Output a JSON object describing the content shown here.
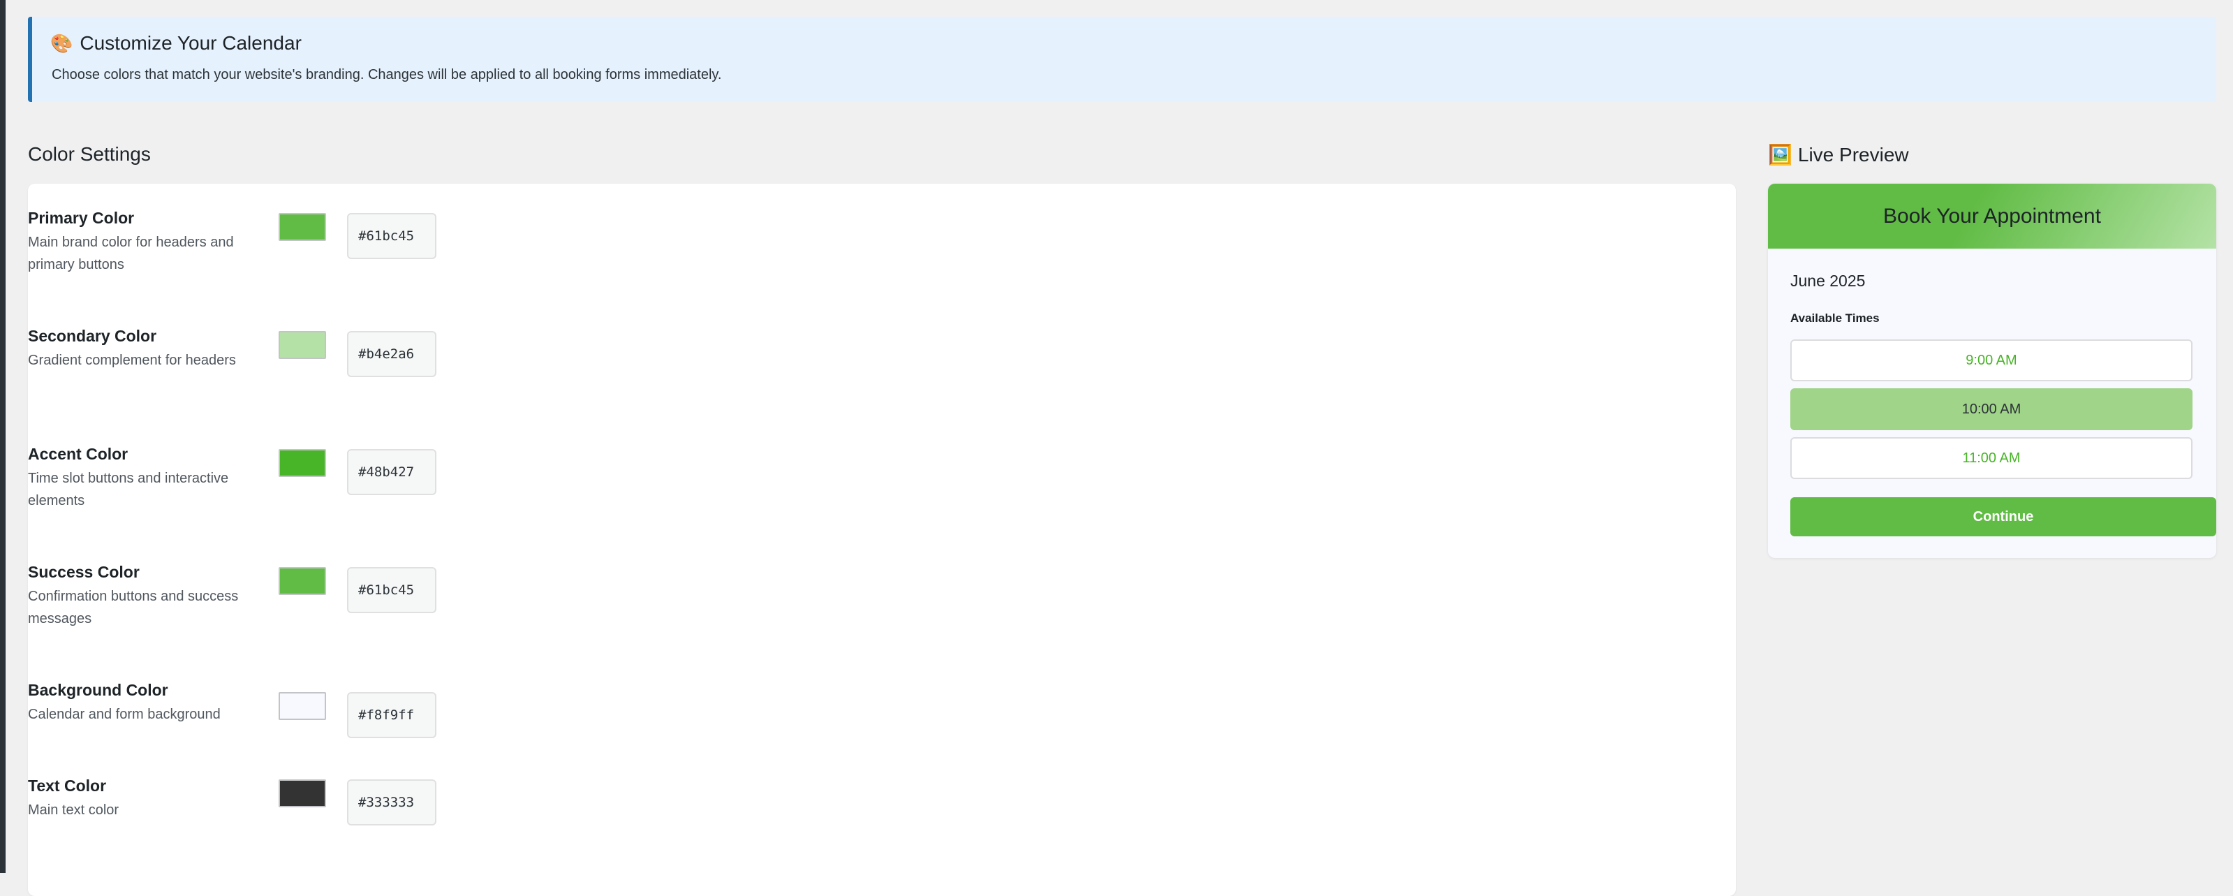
{
  "notice": {
    "icon": "palette-icon",
    "title": "Customize Your Calendar",
    "description": "Choose colors that match your website's branding. Changes will be applied to all booking forms immediately."
  },
  "settings": {
    "title": "Color Settings",
    "colors": [
      {
        "label": "Primary Color",
        "description": "Main brand color for headers and primary buttons",
        "value": "#61bc45"
      },
      {
        "label": "Secondary Color",
        "description": "Gradient complement for headers",
        "value": "#b4e2a6"
      },
      {
        "label": "Accent Color",
        "description": "Time slot buttons and interactive elements",
        "value": "#48b427"
      },
      {
        "label": "Success Color",
        "description": "Confirmation buttons and success messages",
        "value": "#61bc45"
      },
      {
        "label": "Background Color",
        "description": "Calendar and form background",
        "value": "#f8f9ff"
      },
      {
        "label": "Text Color",
        "description": "Main text color",
        "value": "#333333"
      }
    ]
  },
  "preview": {
    "icon": "picture-icon",
    "title": "Live Preview",
    "heading": "Book Your Appointment",
    "month": "June 2025",
    "available_label": "Available Times",
    "slots": [
      {
        "label": "9:00 AM",
        "selected": false
      },
      {
        "label": "10:00 AM",
        "selected": true
      },
      {
        "label": "11:00 AM",
        "selected": false
      }
    ],
    "continue_label": "Continue"
  },
  "colors": {
    "admin_bar": "#2c3338",
    "notice_bg": "#e5f1fd",
    "notice_border": "#2271b1",
    "slot_selected": "#a0d488"
  }
}
